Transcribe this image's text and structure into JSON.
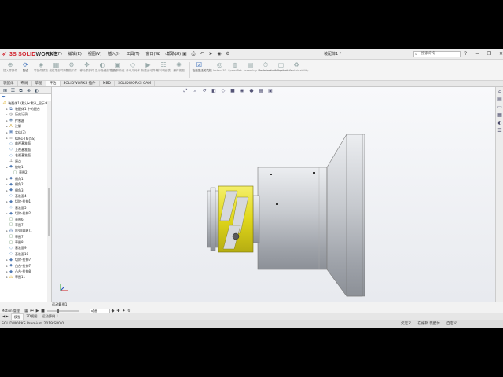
{
  "app": {
    "logo_text_a": "3S SOLID",
    "logo_text_b": "WORKS",
    "document_title": "装配体1 *",
    "search_placeholder": "搜索命令",
    "window_controls": [
      "?",
      "−",
      "❐",
      "✕"
    ]
  },
  "menu": [
    "文件(F)",
    "编辑(E)",
    "视图(V)",
    "插入(I)",
    "工具(T)",
    "窗口(W)",
    "帮助(H)"
  ],
  "command_manager": [
    {
      "label": "插入零部件",
      "active": false
    },
    {
      "label": "配合",
      "active": true
    },
    {
      "label": "零部件预览",
      "active": false
    },
    {
      "label": "线性零部件阵列",
      "active": false
    },
    {
      "label": "智能扣件",
      "active": false
    },
    {
      "label": "移动零部件",
      "active": false
    },
    {
      "label": "显示隐藏的零部件",
      "active": false
    },
    {
      "label": "装配体特征",
      "active": false
    },
    {
      "label": "参考几何体",
      "active": false
    },
    {
      "label": "新建运动算例",
      "active": false
    },
    {
      "label": "材料明细表",
      "active": false
    },
    {
      "label": "爆炸视图",
      "active": false
    },
    {
      "label": "检查激活的文档",
      "active": true
    },
    {
      "label": "Instant3D",
      "active": false
    },
    {
      "label": "SpeedPak",
      "active": false
    },
    {
      "label": "Assembly Visualization",
      "active": false
    },
    {
      "label": "Performance Evaluation",
      "active": false
    },
    {
      "label": "Snapshot",
      "active": false
    },
    {
      "label": "Sustainability",
      "active": false
    }
  ],
  "tabs": [
    {
      "label": "装配体",
      "active": false
    },
    {
      "label": "布局",
      "active": false
    },
    {
      "label": "草图",
      "active": false
    },
    {
      "label": "评估",
      "active": true
    },
    {
      "label": "SOLIDWORKS 插件",
      "active": false
    },
    {
      "label": "MBD",
      "active": false
    },
    {
      "label": "SOLIDWORKS CAM",
      "active": false
    }
  ],
  "feature_tree": [
    {
      "label": "装配体1 (默认<默认_显示状态-1>)",
      "indent": 0,
      "icon": "assembly",
      "color": "#d9a400"
    },
    {
      "label": "装配体1 中的配合",
      "indent": 1,
      "icon": "mates",
      "color": "#5a7fb5"
    },
    {
      "label": "历史记录",
      "indent": 1,
      "icon": "history",
      "color": "#7a7a7a"
    },
    {
      "label": "传感器",
      "indent": 1,
      "icon": "sensor",
      "color": "#6a8bb0"
    },
    {
      "label": "注解",
      "indent": 1,
      "icon": "annotation",
      "color": "#c8a030"
    },
    {
      "label": "实体(3)",
      "indent": 1,
      "icon": "solid",
      "color": "#6f90c0"
    },
    {
      "label": "6061-T6 (SS)",
      "indent": 1,
      "icon": "material",
      "color": "#8b8b8b"
    },
    {
      "label": "前视基准面",
      "indent": 1,
      "icon": "plane",
      "color": "#6fa0d0"
    },
    {
      "label": "上视基准面",
      "indent": 1,
      "icon": "plane",
      "color": "#6fa0d0"
    },
    {
      "label": "右视基准面",
      "indent": 1,
      "icon": "plane",
      "color": "#6fa0d0"
    },
    {
      "label": "原点",
      "indent": 1,
      "icon": "origin",
      "color": "#3a3a3a"
    },
    {
      "label": "旋转1",
      "indent": 1,
      "icon": "feature",
      "color": "#4f79b2"
    },
    {
      "label": "草图2",
      "indent": 2,
      "icon": "sketch",
      "color": "#5c8a5c"
    },
    {
      "label": "倒角1",
      "indent": 1,
      "icon": "feature",
      "color": "#4f79b2"
    },
    {
      "label": "倒角2",
      "indent": 1,
      "icon": "feature",
      "color": "#4f79b2"
    },
    {
      "label": "倒角3",
      "indent": 1,
      "icon": "feature",
      "color": "#4f79b2"
    },
    {
      "label": "基准面4",
      "indent": 1,
      "icon": "plane",
      "color": "#6fa0d0"
    },
    {
      "label": "切除-拉伸1",
      "indent": 1,
      "icon": "feature",
      "color": "#4f79b2"
    },
    {
      "label": "基准面5",
      "indent": 1,
      "icon": "plane",
      "color": "#6fa0d0"
    },
    {
      "label": "切除-拉伸2",
      "indent": 1,
      "icon": "feature",
      "color": "#4f79b2"
    },
    {
      "label": "草图6",
      "indent": 1,
      "icon": "sketch",
      "color": "#5c8a5c"
    },
    {
      "label": "草图7",
      "indent": 1,
      "icon": "sketch",
      "color": "#5c8a5c"
    },
    {
      "label": "阵列(圆周)1",
      "indent": 1,
      "icon": "pattern",
      "color": "#4f79b2"
    },
    {
      "label": "草图7",
      "indent": 1,
      "icon": "sketch",
      "color": "#5c8a5c"
    },
    {
      "label": "草图8",
      "indent": 1,
      "icon": "sketch",
      "color": "#5c8a5c"
    },
    {
      "label": "基准面9",
      "indent": 1,
      "icon": "plane",
      "color": "#6fa0d0"
    },
    {
      "label": "基准面10",
      "indent": 1,
      "icon": "plane",
      "color": "#6fa0d0"
    },
    {
      "label": "切除-拉伸7",
      "indent": 1,
      "icon": "feature",
      "color": "#4f79b2"
    },
    {
      "label": "凸台-拉伸7",
      "indent": 1,
      "icon": "feature",
      "color": "#4f79b2"
    },
    {
      "label": "凸台-拉伸8",
      "indent": 1,
      "icon": "feature",
      "color": "#4f79b2"
    },
    {
      "label": "草图11",
      "indent": 1,
      "icon": "warning",
      "color": "#d8a000"
    }
  ],
  "motion": {
    "header": "运动算例1",
    "study_type": "动画",
    "panel_label": "Motion 管理"
  },
  "bottom_tabs": [
    {
      "label": "模型",
      "active": true
    },
    {
      "label": "3D视图",
      "active": false
    },
    {
      "label": "运动算例 1",
      "active": false
    }
  ],
  "status": {
    "left": "SOLIDWORKS Premium 2019 SP0.0",
    "items": [
      "欠定义",
      "在编辑 装配体",
      "自定义"
    ]
  },
  "colors": {
    "accent_blue": "#2a63b5",
    "logo_red": "#d0202a",
    "part_gray": "#b9bcc1",
    "part_yellow": "#e7df1e"
  }
}
